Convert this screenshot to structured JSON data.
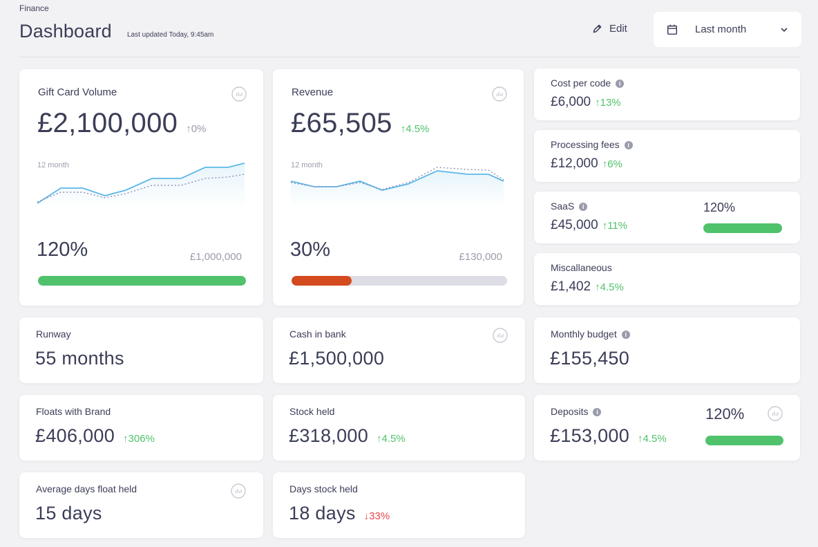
{
  "header": {
    "section": "Finance",
    "title": "Dashboard",
    "updated": "Last updated Today, 9:45am",
    "edit_label": "Edit",
    "date_range": "Last month"
  },
  "colors": {
    "green": "#4fc26b",
    "red": "#e5484d",
    "orange": "#d24a1e",
    "blue_line": "#5ab7e8",
    "text": "#3b3d57"
  },
  "gift_card_volume": {
    "label": "Gift Card Volume",
    "value": "£2,100,000",
    "delta": "0%",
    "spark_label": "12 month",
    "progress_pct": "120%",
    "target": "£1,000,000",
    "progress": 1.0
  },
  "revenue": {
    "label": "Revenue",
    "value": "£65,505",
    "delta": "4.5%",
    "spark_label": "12 month",
    "progress_pct": "30%",
    "target": "£130,000",
    "progress": 0.3
  },
  "cost_per_code": {
    "label": "Cost per code",
    "value": "£6,000",
    "delta": "13%"
  },
  "processing_fees": {
    "label": "Processing fees",
    "value": "£12,000",
    "delta": "6%"
  },
  "saas": {
    "label": "SaaS",
    "value": "£45,000",
    "delta": "11%",
    "progress_pct": "120%",
    "progress": 1.0
  },
  "miscellaneous": {
    "label": "Miscallaneous",
    "value": "£1,402",
    "delta": "4.5%"
  },
  "runway": {
    "label": "Runway",
    "value": "55 months"
  },
  "cash_in_bank": {
    "label": "Cash in bank",
    "value": "£1,500,000"
  },
  "monthly_budget": {
    "label": "Monthly budget",
    "value": "£155,450"
  },
  "floats_with_brand": {
    "label": "Floats with Brand",
    "value": "£406,000",
    "delta": "306%"
  },
  "stock_held": {
    "label": "Stock held",
    "value": "£318,000",
    "delta": "4.5%"
  },
  "deposits": {
    "label": "Deposits",
    "value": "£153,000",
    "delta": "4.5%",
    "progress_pct": "120%",
    "progress": 1.0
  },
  "avg_days_float": {
    "label": "Average days float held",
    "value": "15 days"
  },
  "days_stock_held": {
    "label": "Days stock held",
    "value": "18 days",
    "delta": "33%"
  },
  "icons": [
    "pencil-icon",
    "calendar-icon",
    "chevron-down-icon",
    "bar-chart-icon",
    "info-icon",
    "arrow-up-icon",
    "arrow-down-icon"
  ]
}
